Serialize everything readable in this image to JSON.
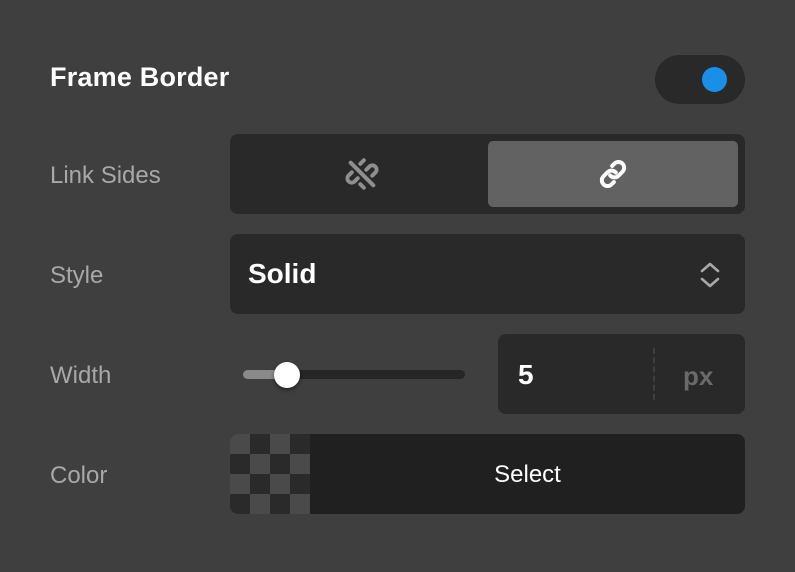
{
  "section": {
    "title": "Frame Border",
    "toggle_on": true,
    "accent_color": "#1a8fe8"
  },
  "link_sides": {
    "label": "Link Sides",
    "options": [
      {
        "icon": "unlink-icon",
        "selected": false
      },
      {
        "icon": "link-icon",
        "selected": true
      }
    ]
  },
  "style": {
    "label": "Style",
    "value": "Solid"
  },
  "width": {
    "label": "Width",
    "value": "5",
    "unit": "px",
    "slider_fraction": 0.2
  },
  "color": {
    "label": "Color",
    "button_label": "Select"
  }
}
